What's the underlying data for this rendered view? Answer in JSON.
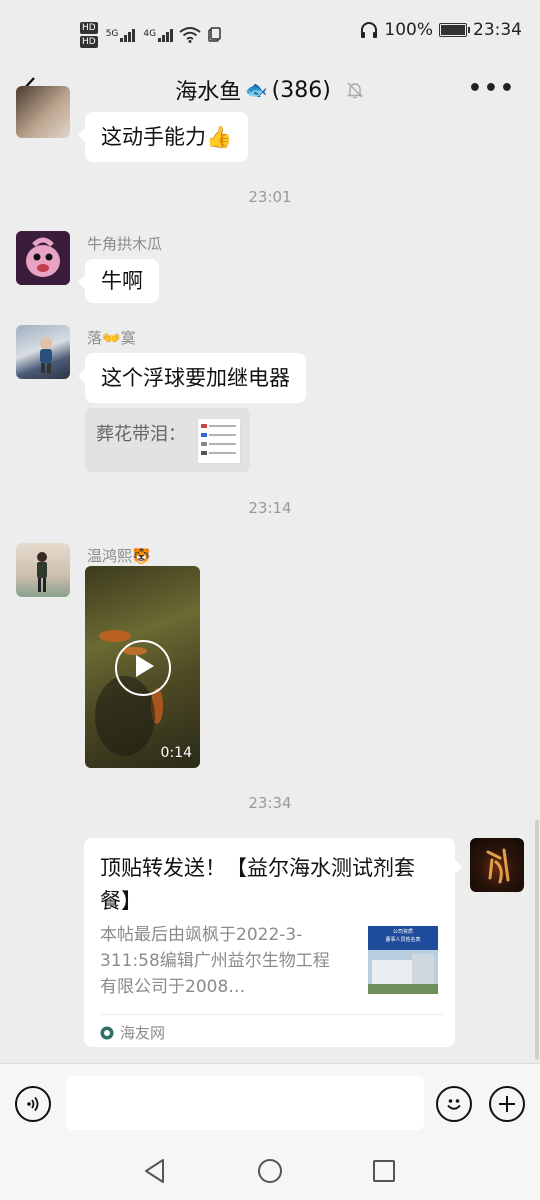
{
  "status_bar": {
    "hd_top": "HD",
    "hd_bottom": "HD",
    "sim1_gen": "5G",
    "sim2_gen": "4G",
    "battery": "100%",
    "time": "23:34"
  },
  "header": {
    "title": "海水鱼",
    "title_emoji": "🐟",
    "member_count": "(386)",
    "more_label": "•••"
  },
  "messages": {
    "partial_bubble": "这动手能力👍",
    "time_1": "23:01",
    "msg1": {
      "sender": "牛角拱木瓜",
      "text": "牛啊"
    },
    "msg2": {
      "sender": "落👐寞",
      "text": "这个浮球要加继电器",
      "quote_label": "葬花带泪："
    },
    "time_2": "23:14",
    "msg3": {
      "sender": "温鸿熙🐯",
      "video_duration": "0:14"
    },
    "time_3": "23:34",
    "card": {
      "title": "顶贴转发送！【益尔海水测试剂套餐】",
      "desc": "本帖最后由飒枫于2022-3-311:58编辑广州益尔生物工程有限公司于2008…",
      "source": "海友网",
      "thumb_line1": "公司资质",
      "thumb_line2": "董事人员姓名表"
    }
  },
  "input_bar": {
    "placeholder": ""
  },
  "colors": {
    "background": "#ededed",
    "bubble": "#ffffff",
    "accent_avatar_bg": "#3a1d3a"
  }
}
